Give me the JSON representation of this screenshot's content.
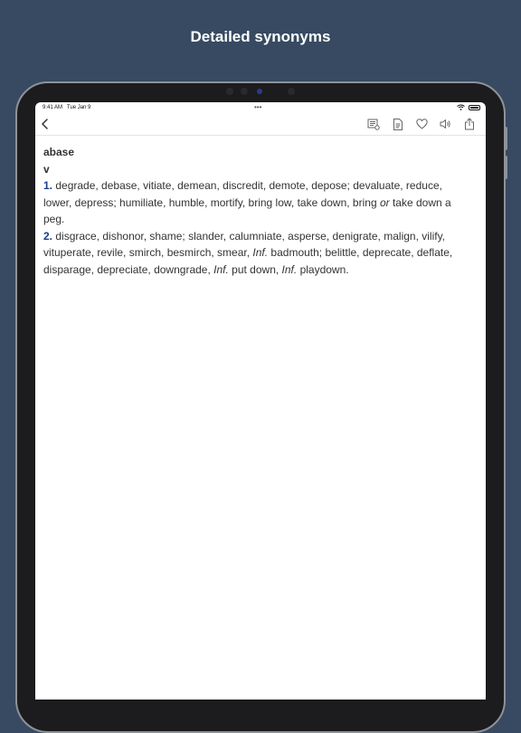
{
  "headline": "Detailed synonyms",
  "status": {
    "time": "9:41 AM",
    "date": "Tue Jan 9",
    "dots": "•••"
  },
  "toolbar": {
    "back": "back-chevron",
    "icons": [
      "flashcard-icon",
      "document-icon",
      "heart-icon",
      "speaker-icon",
      "share-icon"
    ]
  },
  "entry": {
    "word": "abase",
    "pos": "v",
    "senses": [
      {
        "num": "1.",
        "seg1": " degrade, debase, vitiate, demean, discredit, demote, depose; devaluate, reduce, lower, depress; humiliate, humble, mortify, bring low, take down, bring ",
        "or": "or",
        "seg2": " take down a peg."
      },
      {
        "num": "2.",
        "seg1": " disgrace, dishonor, shame; slander, calumniate, asperse, denigrate, malign, vilify, vituperate, revile, smirch, besmirch, smear, ",
        "inf1": "Inf.",
        "seg2": " badmouth; belittle, deprecate, deflate, disparage, depreciate, downgrade, ",
        "inf2": "Inf.",
        "seg3": " put down, ",
        "inf3": "Inf.",
        "seg4": " playdown."
      }
    ]
  }
}
